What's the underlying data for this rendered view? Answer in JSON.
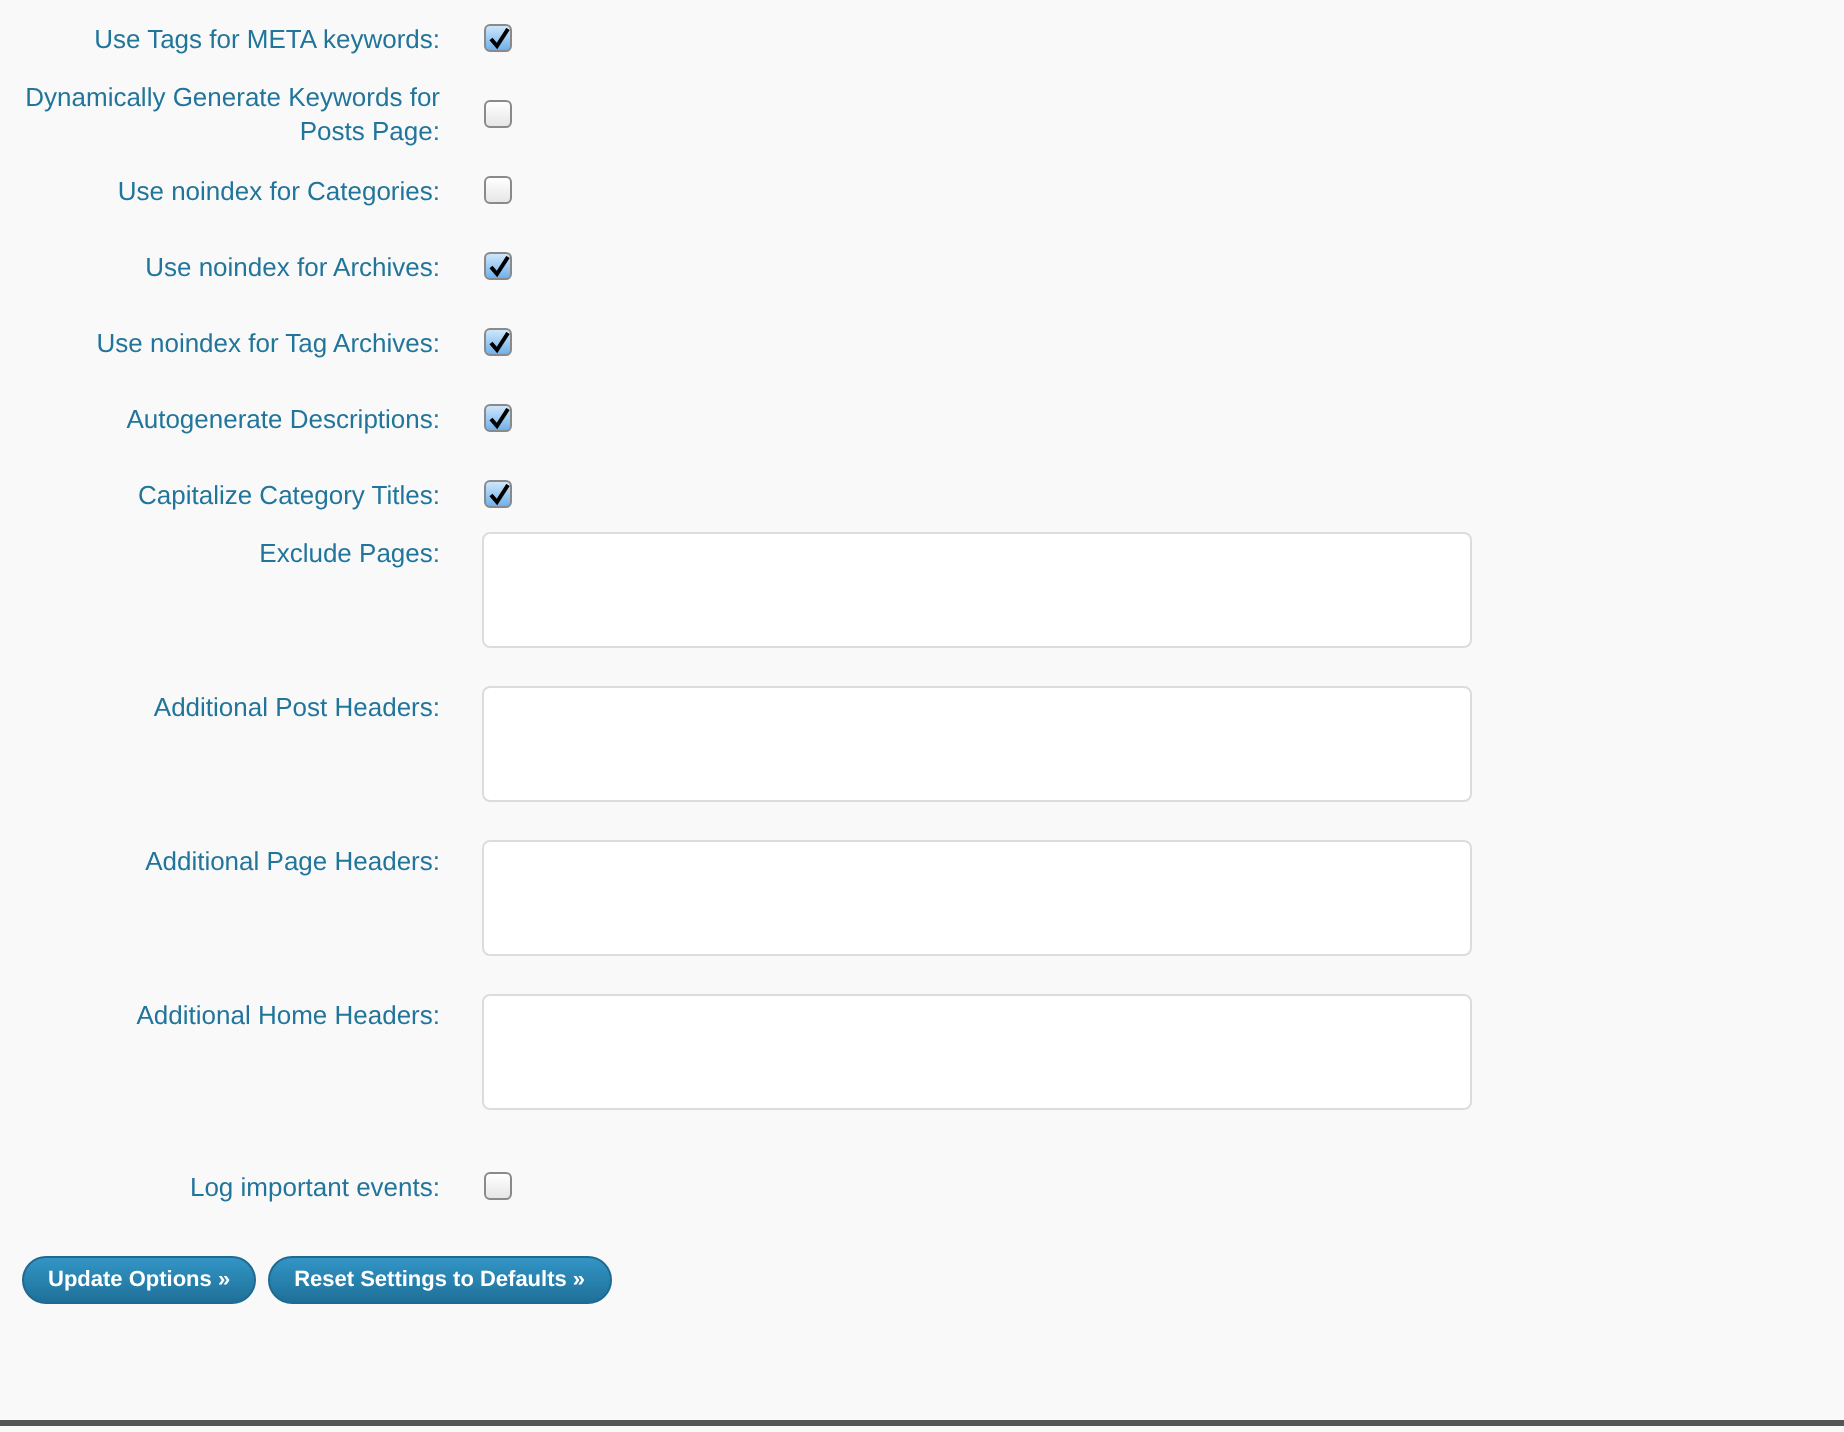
{
  "options": [
    {
      "kind": "checkbox",
      "label": "Use Tags for META keywords:",
      "checked": true
    },
    {
      "kind": "checkbox",
      "label": "Dynamically Generate Keywords for Posts Page:",
      "checked": false
    },
    {
      "kind": "checkbox",
      "label": "Use noindex for Categories:",
      "checked": false
    },
    {
      "kind": "checkbox",
      "label": "Use noindex for Archives:",
      "checked": true
    },
    {
      "kind": "checkbox",
      "label": "Use noindex for Tag Archives:",
      "checked": true
    },
    {
      "kind": "checkbox",
      "label": "Autogenerate Descriptions:",
      "checked": true
    },
    {
      "kind": "checkbox",
      "label": "Capitalize Category Titles:",
      "checked": true
    },
    {
      "kind": "textarea",
      "label": "Exclude Pages:"
    },
    {
      "kind": "textarea",
      "label": "Additional Post Headers:"
    },
    {
      "kind": "textarea",
      "label": "Additional Page Headers:"
    },
    {
      "kind": "textarea",
      "label": "Additional Home Headers:"
    },
    {
      "kind": "checkbox",
      "label": "Log important events:",
      "checked": false
    }
  ],
  "buttons": [
    "Update Options »",
    "Reset Settings to Defaults »"
  ]
}
